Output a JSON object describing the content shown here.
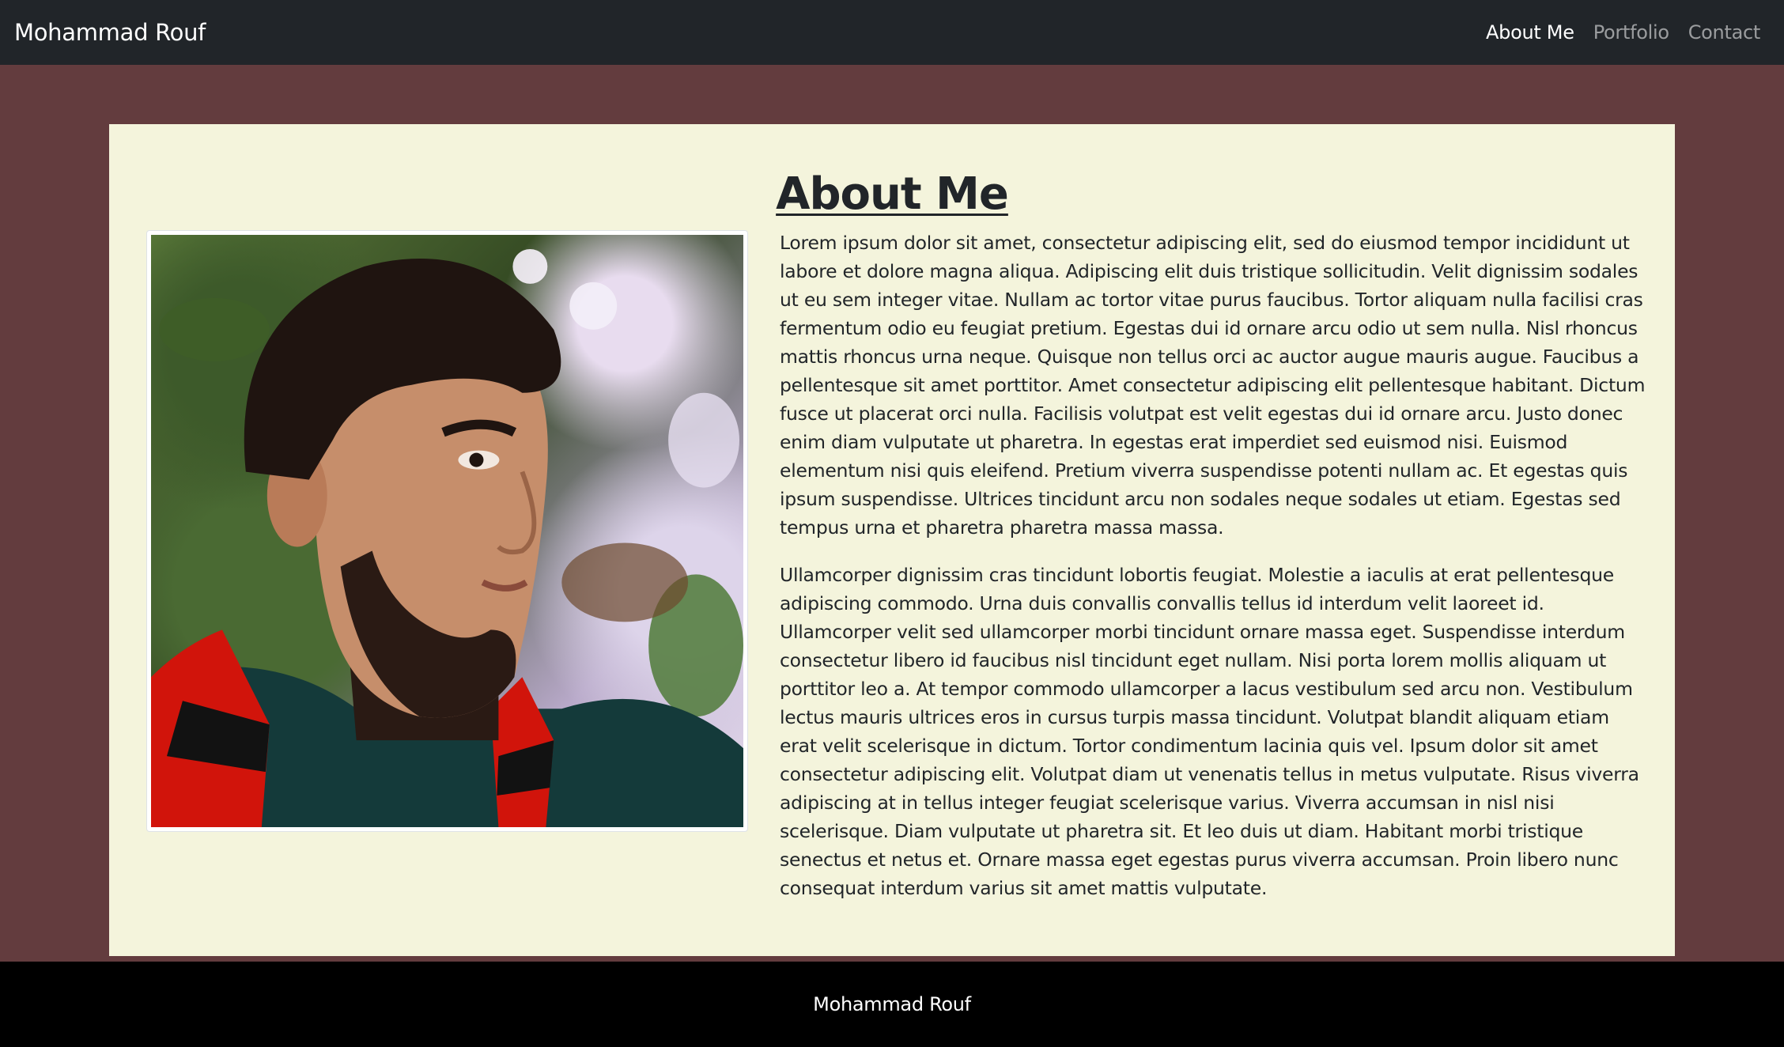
{
  "navbar": {
    "brand": "Mohammad Rouf",
    "links": [
      {
        "label": "About Me",
        "active": true
      },
      {
        "label": "Portfolio",
        "active": false
      },
      {
        "label": "Contact",
        "active": false
      }
    ]
  },
  "main": {
    "title": "About Me",
    "paragraphs": [
      "Lorem ipsum dolor sit amet, consectetur adipiscing elit, sed do eiusmod tempor incididunt ut labore et dolore magna aliqua. Adipiscing elit duis tristique sollicitudin. Velit dignissim sodales ut eu sem integer vitae. Nullam ac tortor vitae purus faucibus. Tortor aliquam nulla facilisi cras fermentum odio eu feugiat pretium. Egestas dui id ornare arcu odio ut sem nulla. Nisl rhoncus mattis rhoncus urna neque. Quisque non tellus orci ac auctor augue mauris augue. Faucibus a pellentesque sit amet porttitor. Amet consectetur adipiscing elit pellentesque habitant. Dictum fusce ut placerat orci nulla. Facilisis volutpat est velit egestas dui id ornare arcu. Justo donec enim diam vulputate ut pharetra. In egestas erat imperdiet sed euismod nisi. Euismod elementum nisi quis eleifend. Pretium viverra suspendisse potenti nullam ac. Et egestas quis ipsum suspendisse. Ultrices tincidunt arcu non sodales neque sodales ut etiam. Egestas sed tempus urna et pharetra pharetra massa massa.",
      "Ullamcorper dignissim cras tincidunt lobortis feugiat. Molestie a iaculis at erat pellentesque adipiscing commodo. Urna duis convallis convallis tellus id interdum velit laoreet id. Ullamcorper velit sed ullamcorper morbi tincidunt ornare massa eget. Suspendisse interdum consectetur libero id faucibus nisl tincidunt eget nullam. Nisi porta lorem mollis aliquam ut porttitor leo a. At tempor commodo ullamcorper a lacus vestibulum sed arcu non. Vestibulum lectus mauris ultrices eros in cursus turpis massa tincidunt. Volutpat blandit aliquam etiam erat velit scelerisque in dictum. Tortor condimentum lacinia quis vel. Ipsum dolor sit amet consectetur adipiscing elit. Volutpat diam ut venenatis tellus in metus vulputate. Risus viverra adipiscing at in tellus integer feugiat scelerisque varius. Viverra accumsan in nisl nisi scelerisque. Diam vulputate ut pharetra sit. Et leo duis ut diam. Habitant morbi tristique senectus et netus et. Ornare massa eget egestas purus viverra accumsan. Proin libero nunc consequat interdum varius sit amet mattis vulputate."
    ]
  },
  "footer": {
    "text": "Mohammad Rouf"
  },
  "colors": {
    "navbar_bg": "#212529",
    "page_bg": "#633c3e",
    "card_bg": "#f4f4dc",
    "footer_bg": "#000000"
  }
}
